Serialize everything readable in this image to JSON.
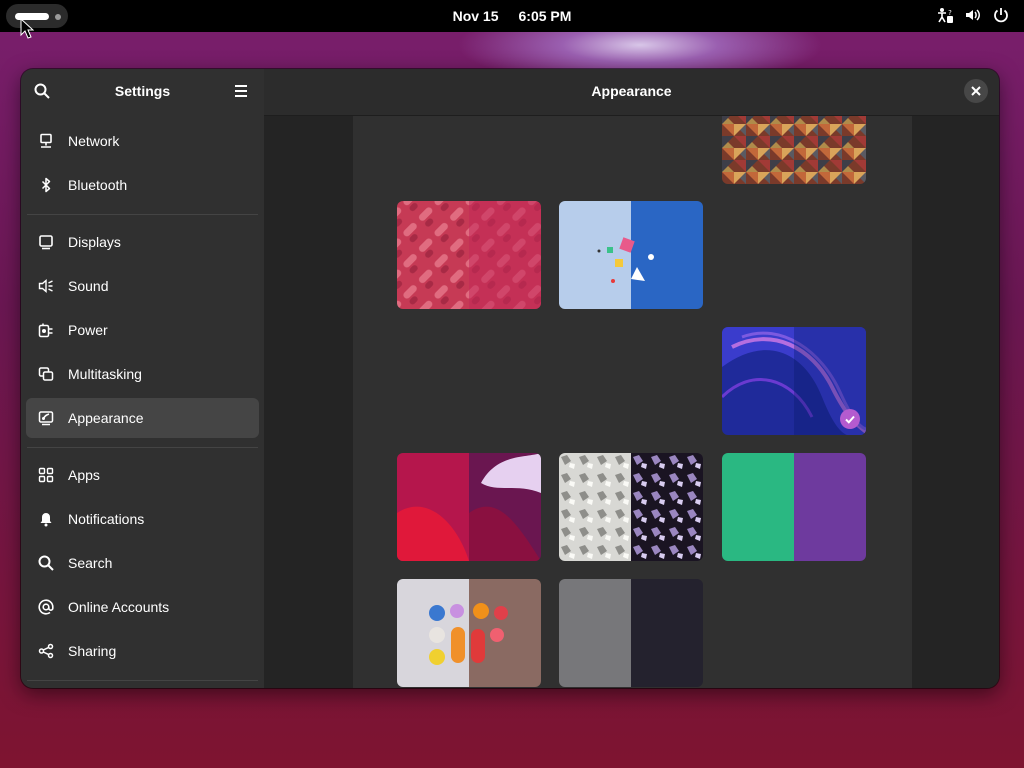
{
  "topbar": {
    "date": "Nov 15",
    "time": "6:05 PM",
    "tray_icons": [
      "accessibility-icon",
      "volume-icon",
      "power-icon"
    ]
  },
  "window": {
    "sidebar": {
      "title": "Settings",
      "items": [
        {
          "label": "Network",
          "icon": "network-icon"
        },
        {
          "label": "Bluetooth",
          "icon": "bluetooth-icon"
        },
        {
          "label": "Displays",
          "icon": "display-icon"
        },
        {
          "label": "Sound",
          "icon": "sound-icon"
        },
        {
          "label": "Power",
          "icon": "power-plug-icon"
        },
        {
          "label": "Multitasking",
          "icon": "multitasking-icon"
        },
        {
          "label": "Appearance",
          "icon": "appearance-icon",
          "selected": true
        },
        {
          "label": "Apps",
          "icon": "apps-grid-icon"
        },
        {
          "label": "Notifications",
          "icon": "bell-icon"
        },
        {
          "label": "Search",
          "icon": "search-icon"
        },
        {
          "label": "Online Accounts",
          "icon": "at-sign-icon"
        },
        {
          "label": "Sharing",
          "icon": "share-icon"
        }
      ]
    },
    "content": {
      "title": "Appearance",
      "selected_wallpaper": "blue-purple-waves"
    }
  },
  "colors": {
    "accent": "#b45bcf",
    "sidebar_bg": "#303030",
    "selected_bg": "#454545"
  }
}
